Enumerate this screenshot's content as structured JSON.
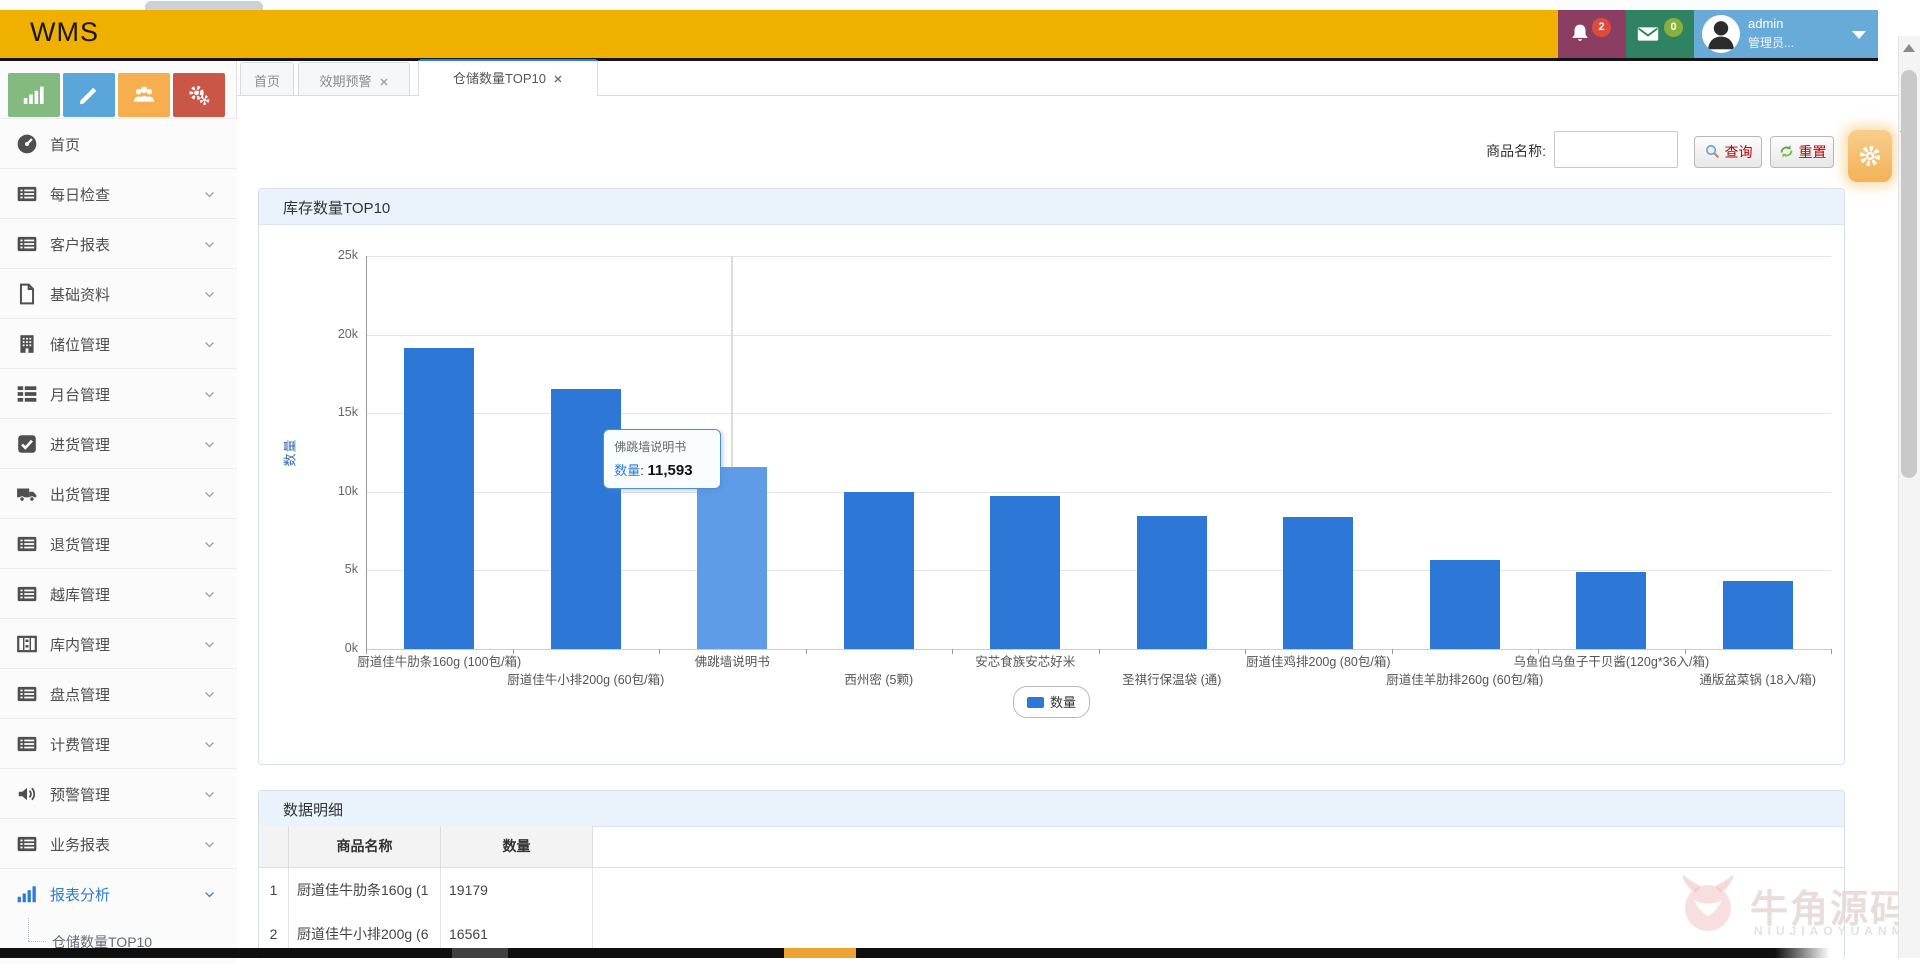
{
  "topbar": {
    "brand": "WMS",
    "bell_badge": "2",
    "mail_badge": "0",
    "user_name": "admin",
    "user_role": "管理员...",
    "colors": {
      "bar": "#f0b000",
      "bell_block": "#8b3d62",
      "bell_badge": "#de4b3b",
      "mail_block": "#2f8363",
      "mail_badge": "#86b23a",
      "user_block": "#68abd8"
    }
  },
  "sidebar": {
    "shortcuts": [
      {
        "icon": "chart",
        "color": "#82ba7f"
      },
      {
        "icon": "pencil",
        "color": "#5aa5da"
      },
      {
        "icon": "users",
        "color": "#f7ae4e"
      },
      {
        "icon": "gears",
        "color": "#ca5648"
      }
    ],
    "items": [
      {
        "label": "首页",
        "icon": "gauge",
        "chevron": false,
        "active": false
      },
      {
        "label": "每日检查",
        "icon": "list",
        "chevron": true,
        "active": false
      },
      {
        "label": "客户报表",
        "icon": "list",
        "chevron": true,
        "active": false
      },
      {
        "label": "基础资料",
        "icon": "file",
        "chevron": true,
        "active": false
      },
      {
        "label": "储位管理",
        "icon": "building",
        "chevron": true,
        "active": false
      },
      {
        "label": "月台管理",
        "icon": "rows",
        "chevron": true,
        "active": false
      },
      {
        "label": "进货管理",
        "icon": "check",
        "chevron": true,
        "active": false
      },
      {
        "label": "出货管理",
        "icon": "truck",
        "chevron": true,
        "active": false
      },
      {
        "label": "退货管理",
        "icon": "list",
        "chevron": true,
        "active": false
      },
      {
        "label": "越库管理",
        "icon": "list",
        "chevron": true,
        "active": false
      },
      {
        "label": "库内管理",
        "icon": "film",
        "chevron": true,
        "active": false
      },
      {
        "label": "盘点管理",
        "icon": "list",
        "chevron": true,
        "active": false
      },
      {
        "label": "计费管理",
        "icon": "list",
        "chevron": true,
        "active": false
      },
      {
        "label": "预警管理",
        "icon": "volume",
        "chevron": true,
        "active": false
      },
      {
        "label": "业务报表",
        "icon": "list",
        "chevron": true,
        "active": false
      },
      {
        "label": "报表分析",
        "icon": "chart",
        "chevron": true,
        "active": true
      }
    ],
    "sub_item": {
      "label": "仓储数量TOP10"
    },
    "active_color": "#2d7dd2"
  },
  "tabs": [
    {
      "label": "首页",
      "closable": false,
      "active": false
    },
    {
      "label": "效期预警",
      "closable": true,
      "active": false
    },
    {
      "label": "仓储数量TOP10",
      "closable": true,
      "active": true
    }
  ],
  "search": {
    "label": "商品名称:",
    "input_value": "",
    "query_label": "查询",
    "reset_label": "重置"
  },
  "chart_panel": {
    "title": "库存数量TOP10"
  },
  "chart_data": {
    "type": "bar",
    "title": "库存数量TOP10",
    "ylabel": "数量",
    "series_name": "数量",
    "categories": [
      "厨道佳牛肋条160g (100包/箱)",
      "厨道佳牛小排200g (60包/箱)",
      "佛跳墙说明书",
      "西州密 (5颗)",
      "安芯食族安芯好米",
      "圣祺行保温袋 (通)",
      "厨道佳鸡排200g (80包/箱)",
      "厨道佳羊肋排260g (60包/箱)",
      "乌鱼伯乌鱼子干贝酱(120g*36入/箱)",
      "通版盆菜锅 (18入/箱)"
    ],
    "values": [
      19179,
      16561,
      11593,
      9966,
      9733,
      8440,
      8397,
      5662,
      4924,
      4300
    ],
    "ylim": [
      0,
      25000
    ],
    "ytick_labels": [
      "0k",
      "5k",
      "10k",
      "15k",
      "20k",
      "25k"
    ],
    "grid": true,
    "legend_position": "bottom",
    "bar_color": "#2d78d6",
    "highlight_index": 2,
    "highlight_color": "#5e9ce8"
  },
  "tooltip": {
    "title": "佛跳墙说明书",
    "series_label": "数量",
    "separator": ": ",
    "value": "11,593"
  },
  "detail_panel": {
    "title": "数据明细",
    "columns": [
      "",
      "商品名称",
      "数量"
    ],
    "rows": [
      {
        "index": "1",
        "name": "厨道佳牛肋条160g (1",
        "qty": "19179"
      },
      {
        "index": "2",
        "name": "厨道佳牛小排200g (6",
        "qty": "16561"
      }
    ]
  },
  "watermark": {
    "text": "牛角源码",
    "subtext": "NIUJIAOYUANMA"
  }
}
